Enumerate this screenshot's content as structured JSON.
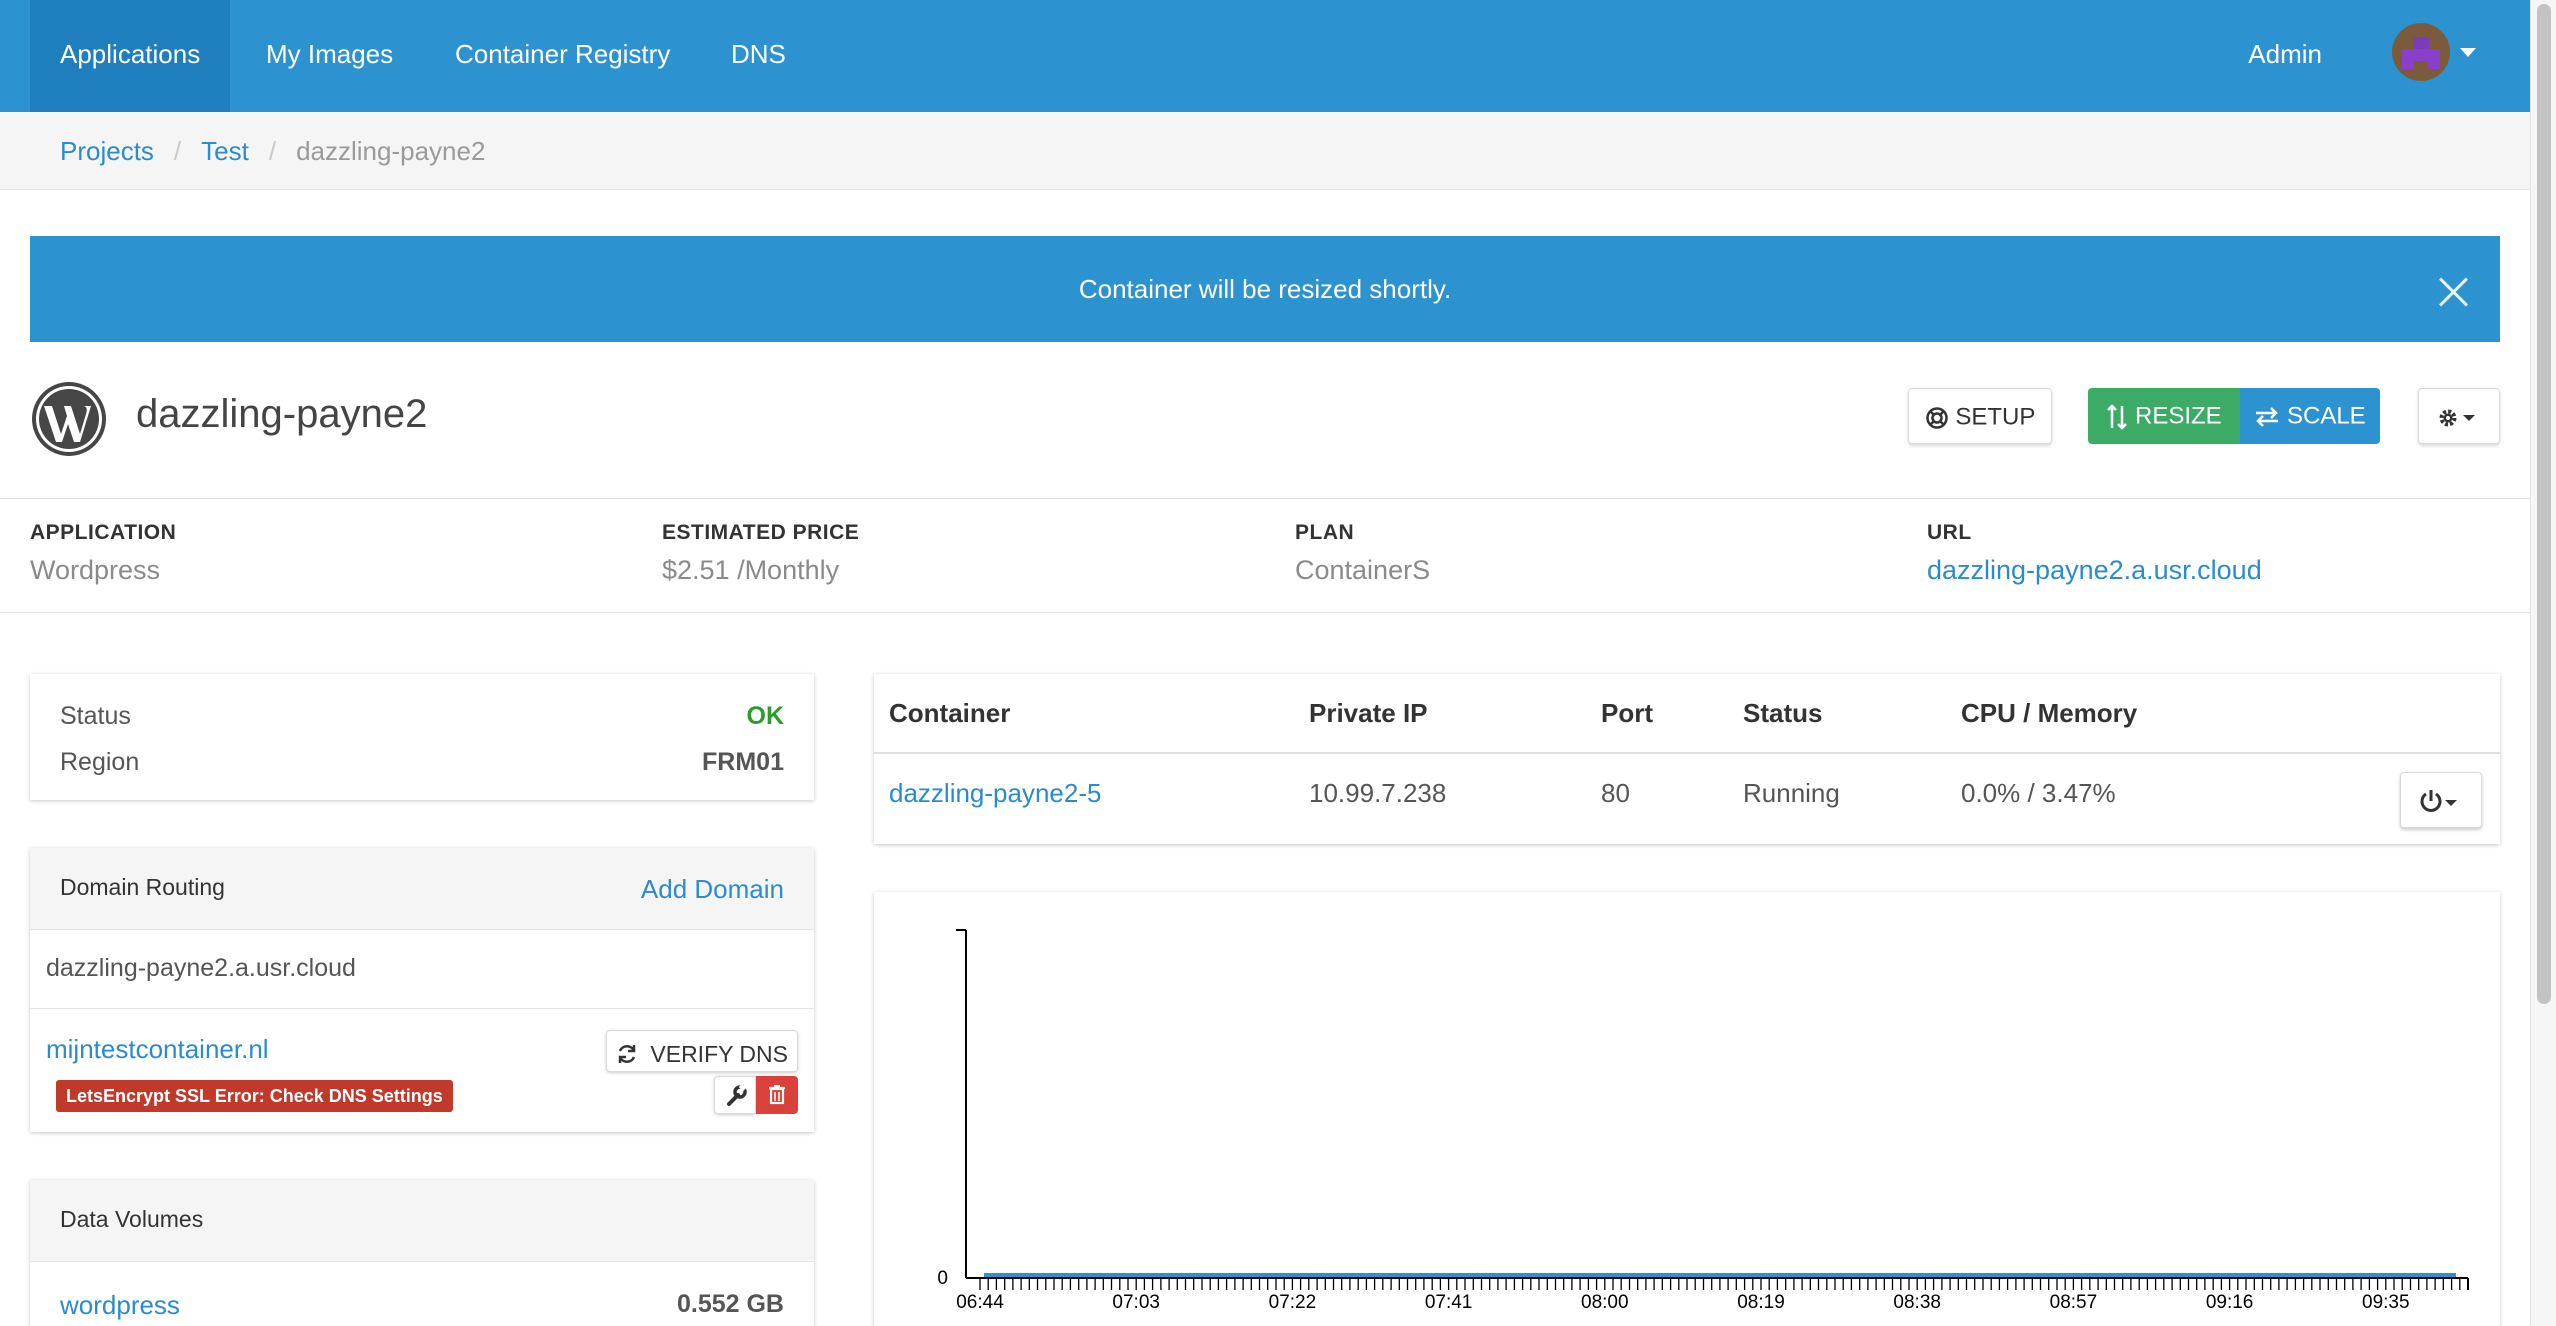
{
  "nav": {
    "items": [
      {
        "label": "Applications",
        "active": true
      },
      {
        "label": "My Images",
        "active": false
      },
      {
        "label": "Container Registry",
        "active": false
      },
      {
        "label": "DNS",
        "active": false
      }
    ],
    "user": "Admin"
  },
  "breadcrumb": {
    "items": [
      "Projects",
      "Test"
    ],
    "current": "dazzling-payne2"
  },
  "alert": {
    "message": "Container will be resized shortly."
  },
  "app": {
    "title": "dazzling-payne2",
    "logo_icon": "wordpress-icon",
    "buttons": {
      "setup": "SETUP",
      "resize": "RESIZE",
      "scale": "SCALE"
    }
  },
  "info": {
    "application": {
      "label": "APPLICATION",
      "value": "Wordpress"
    },
    "price": {
      "label": "ESTIMATED PRICE",
      "value": "$2.51 /Monthly"
    },
    "plan": {
      "label": "PLAN",
      "value": "ContainerS"
    },
    "url": {
      "label": "URL",
      "value": "dazzling-payne2.a.usr.cloud"
    }
  },
  "status_card": {
    "status_label": "Status",
    "status_value": "OK",
    "region_label": "Region",
    "region_value": "FRM01"
  },
  "domain_routing": {
    "title": "Domain Routing",
    "action": "Add Domain",
    "default_domain": "dazzling-payne2.a.usr.cloud",
    "custom_domain": "mijntestcontainer.nl",
    "ssl_error": "LetsEncrypt SSL Error: Check DNS Settings",
    "verify_label": "VERIFY DNS"
  },
  "data_volumes": {
    "title": "Data Volumes",
    "items": [
      {
        "name": "wordpress",
        "size": "0.552 GB"
      }
    ]
  },
  "containers": {
    "headers": [
      "Container",
      "Private IP",
      "Port",
      "Status",
      "CPU / Memory"
    ],
    "rows": [
      {
        "name": "dazzling-payne2-5",
        "ip": "10.99.7.238",
        "port": "80",
        "status": "Running",
        "usage": "0.0% / 3.47%"
      }
    ]
  },
  "colors": {
    "nav": "#2d92d0",
    "accent": "#2a8bd0",
    "success": "#3bab66",
    "danger": "#c0392b",
    "ok": "#2a9d2a"
  },
  "chart_data": {
    "type": "line",
    "x": [
      "06:44",
      "07:03",
      "07:22",
      "07:41",
      "08:00",
      "08:19",
      "08:38",
      "08:57",
      "09:16",
      "09:35"
    ],
    "series": [
      {
        "values": [
          0,
          0,
          0,
          0,
          0,
          0,
          0,
          0,
          0,
          0
        ]
      }
    ],
    "y_ticks": [
      "0"
    ],
    "title": "",
    "xlabel": "",
    "ylabel": "",
    "grid": false
  }
}
